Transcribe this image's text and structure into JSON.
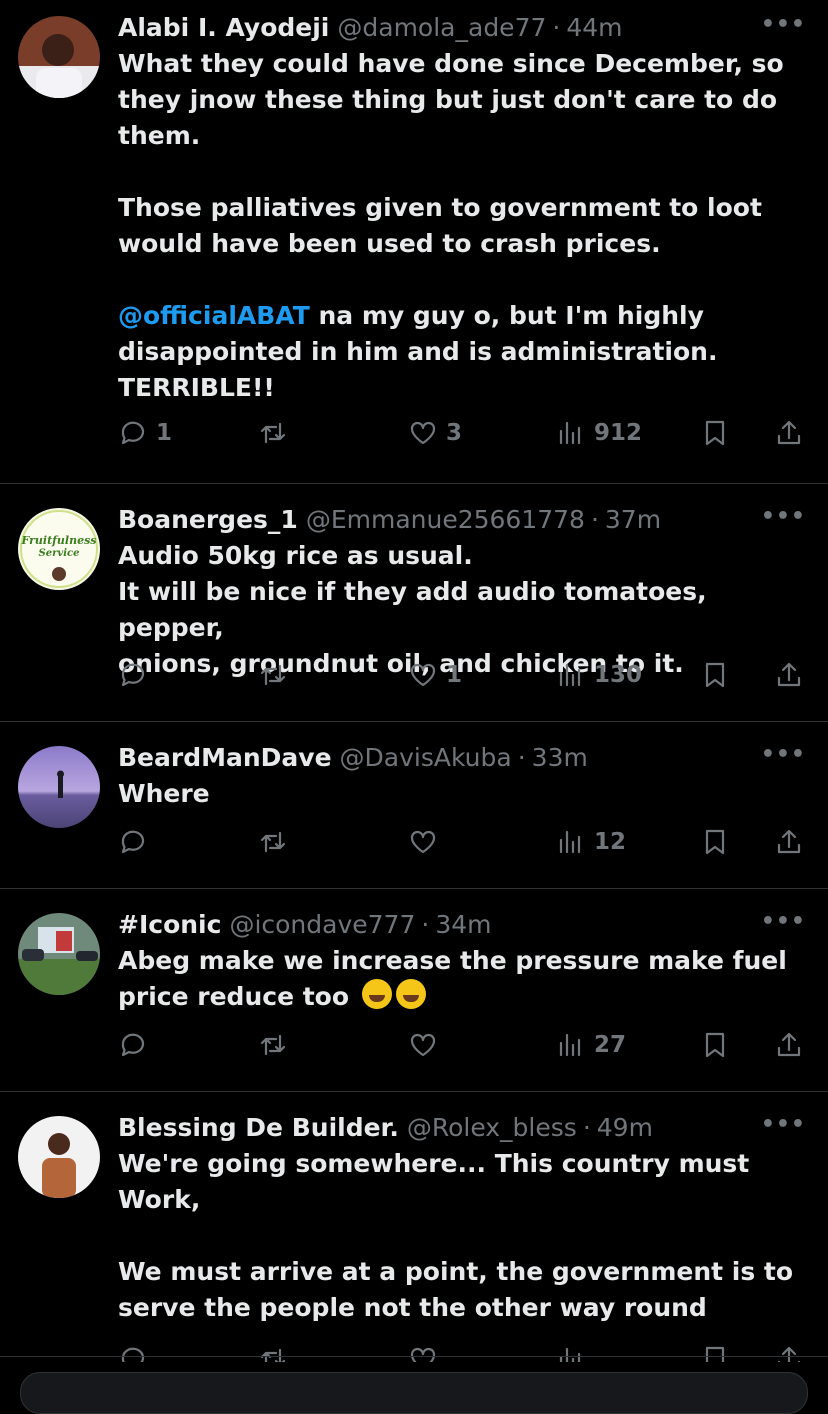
{
  "tweets": [
    {
      "name": "Alabi I. Ayodeji",
      "handle": "@damola_ade77",
      "time": "44m",
      "text_1": "What they could have done since December, so\nthey jnow these thing but just don't care to do\nthem.\n\nThose palliatives given to government to loot\nwould have been used to crash prices.\n\n",
      "mention": "@officialABAT",
      "text_2": " na my guy o, but I'm highly\ndisappointed in him and is administration.\nTERRIBLE!!",
      "replies": "1",
      "retweets": "",
      "likes": "3",
      "views": "912"
    },
    {
      "name": "Boanerges_1",
      "handle": "@Emmanue25661778",
      "time": "37m",
      "text_1": "Audio 50kg rice as usual.\nIt will be nice if they add audio tomatoes, pepper,\nonions, groundnut oil, and chicken to it.",
      "replies": "",
      "retweets": "",
      "likes": "1",
      "views": "130"
    },
    {
      "name": "BeardManDave",
      "handle": "@DavisAkuba",
      "time": "33m",
      "text_1": "Where",
      "replies": "",
      "retweets": "",
      "likes": "",
      "views": "12"
    },
    {
      "name": "#Iconic",
      "handle": "@icondave777",
      "time": "34m",
      "text_1": "Abeg make we increase the pressure make fuel\nprice reduce too",
      "emojis": [
        "rolling-on-floor-laughing",
        "rolling-on-floor-laughing"
      ],
      "replies": "",
      "retweets": "",
      "likes": "",
      "views": "27"
    },
    {
      "name": "Blessing De Builder.",
      "handle": "@Rolex_bless",
      "time": "49m",
      "text_1": "We're going somewhere... This country must\nWork,\n\nWe must arrive at a point, the government is to\nserve the people not the other way round"
    }
  ],
  "sep": "·",
  "more": "•••",
  "avatar_2_text": "Fruitfulness Service",
  "colors": {
    "background": "#000000",
    "text": "#e7e9ea",
    "muted": "#71767b",
    "link": "#1d9bf0",
    "divider": "#2f3336"
  }
}
